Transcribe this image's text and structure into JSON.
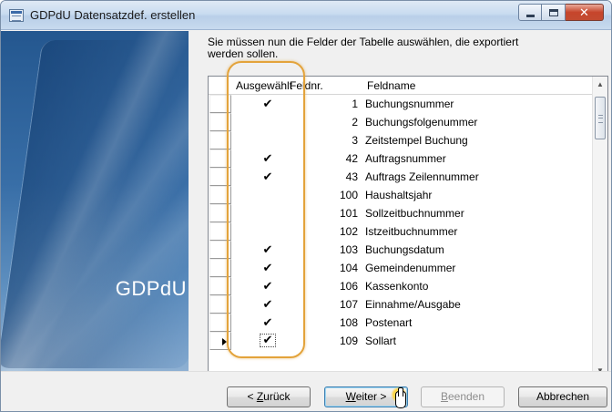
{
  "window": {
    "title": "GDPdU Datensatzdef. erstellen",
    "close_glyph": "✕"
  },
  "banner": {
    "label": "GDPdU"
  },
  "instruction": "Sie müssen nun die Felder der Tabelle auswählen, die exportiert werden sollen.",
  "table": {
    "headers": {
      "selected": "Ausgewählt",
      "field_no": "Feldnr.",
      "field_name": "Feldname"
    },
    "rows": [
      {
        "selected": "✔",
        "nr": "1",
        "name": "Buchungsnummer"
      },
      {
        "selected": "",
        "nr": "2",
        "name": "Buchungsfolgenummer"
      },
      {
        "selected": "",
        "nr": "3",
        "name": "Zeitstempel Buchung"
      },
      {
        "selected": "✔",
        "nr": "42",
        "name": "Auftragsnummer"
      },
      {
        "selected": "✔",
        "nr": "43",
        "name": "Auftrags Zeilennummer"
      },
      {
        "selected": "",
        "nr": "100",
        "name": "Haushaltsjahr"
      },
      {
        "selected": "",
        "nr": "101",
        "name": "Sollzeitbuchnummer"
      },
      {
        "selected": "",
        "nr": "102",
        "name": "Istzeitbuchnummer"
      },
      {
        "selected": "✔",
        "nr": "103",
        "name": "Buchungsdatum"
      },
      {
        "selected": "✔",
        "nr": "104",
        "name": "Gemeindenummer"
      },
      {
        "selected": "✔",
        "nr": "106",
        "name": "Kassenkonto"
      },
      {
        "selected": "✔",
        "nr": "107",
        "name": "Einnahme/Ausgabe"
      },
      {
        "selected": "✔",
        "nr": "108",
        "name": "Postenart"
      },
      {
        "selected": "✔",
        "nr": "109",
        "name": "Sollart"
      }
    ],
    "current_row_index": 13,
    "scroll_up": "▲",
    "scroll_down": "▼"
  },
  "buttons": {
    "back": {
      "underlined": "Z",
      "rest_before": "< ",
      "rest_after": "urück"
    },
    "next": {
      "underlined": "W",
      "rest_before": "",
      "rest_after": "eiter >"
    },
    "finish": {
      "underlined": "B",
      "rest_before": "",
      "rest_after": "eenden"
    },
    "cancel": "Abbrechen"
  },
  "colors": {
    "highlight": "#e3a33b",
    "banner_blue": "#386ea7"
  }
}
